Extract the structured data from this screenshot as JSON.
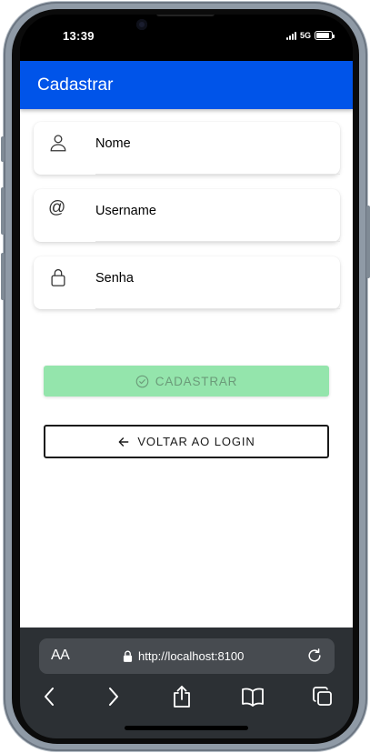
{
  "status_bar": {
    "time": "13:39",
    "network": "5G",
    "battery_level": 0.9
  },
  "header": {
    "title": "Cadastrar",
    "background": "#0054e9"
  },
  "form": {
    "fields": [
      {
        "label": "Nome",
        "icon": "person-icon"
      },
      {
        "label": "Username",
        "icon": "at-icon",
        "glyph": "@"
      },
      {
        "label": "Senha",
        "icon": "lock-icon"
      }
    ],
    "register_button": {
      "label": "CADASTRAR",
      "icon": "checkmark-circle-icon",
      "color": "#94e5ac",
      "disabled": true
    },
    "back_button": {
      "label": "VOLTAR AO LOGIN",
      "icon": "arrow-left-icon"
    }
  },
  "browser": {
    "text_size_label": "AA",
    "url": "http://localhost:8100",
    "toolbar_icons": [
      "back-icon",
      "forward-icon",
      "share-icon",
      "bookmarks-icon",
      "tabs-icon"
    ]
  }
}
